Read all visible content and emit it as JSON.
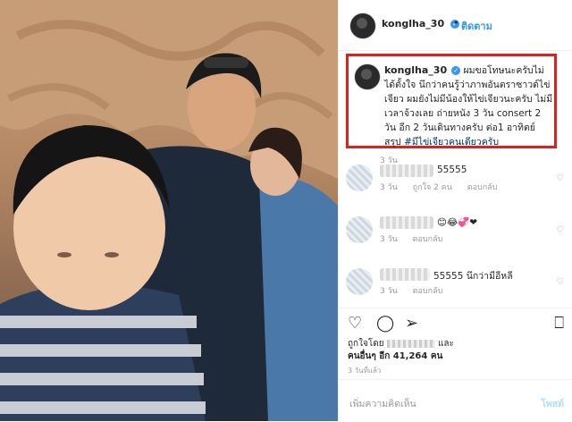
{
  "header": {
    "username": "konglha_30",
    "verified_icon": "✓",
    "separator": "•",
    "follow_label": "ติดตาม"
  },
  "caption": {
    "username": "konglha_30",
    "text": "ผมขอโทษนะครับไม่ได้ตั้งใจ นึกว่าคนรู้ว่าภาพอันตราซาวด์ไข่เจียว ผมยังไม่มีน้องให้ไข่เจียวนะครับ ไม่มีเวลาจ้วงเลย ถ่ายหนัง 3 วัน consert 2 วัน อีก 2 วันเดินทางครับ ต่อ1 อาทิตย์ สรุป",
    "hashtag": "#มีไข่เจียวคนเดียวครับ"
  },
  "comments": [
    {
      "time": "3 วัน",
      "text": "",
      "likes": "",
      "reply": ""
    },
    {
      "time": "3 วัน",
      "text": "55555",
      "likes": "ถูกใจ 2 คน",
      "reply": "ตอบกลับ"
    },
    {
      "time": "3 วัน",
      "text": "😊😂💞❤",
      "likes": "",
      "reply": "ตอบกลับ"
    },
    {
      "time": "3 วัน",
      "text": "",
      "likes": "",
      "reply": "ตอบกลับ"
    },
    {
      "time": "3 วัน",
      "text": "55555 นึกว่ามีอีหลี",
      "likes": "",
      "reply": ""
    }
  ],
  "actions": {
    "like_icon": "heart-icon",
    "comment_icon": "comment-icon",
    "share_icon": "share-icon",
    "save_icon": "bookmark-icon"
  },
  "likes": {
    "liked_by_prefix": "ถูกใจโดย",
    "liked_by_suffix": "และ",
    "others": "คนอื่นๆ อีก 41,264 คน"
  },
  "timeago": "3 วันที่แล้ว",
  "add_comment": {
    "placeholder": "เพิ่มความคิดเห็น",
    "post_label": "โพสต์"
  },
  "colors": {
    "accent": "#3897f0",
    "highlight_border": "#e0201c"
  }
}
